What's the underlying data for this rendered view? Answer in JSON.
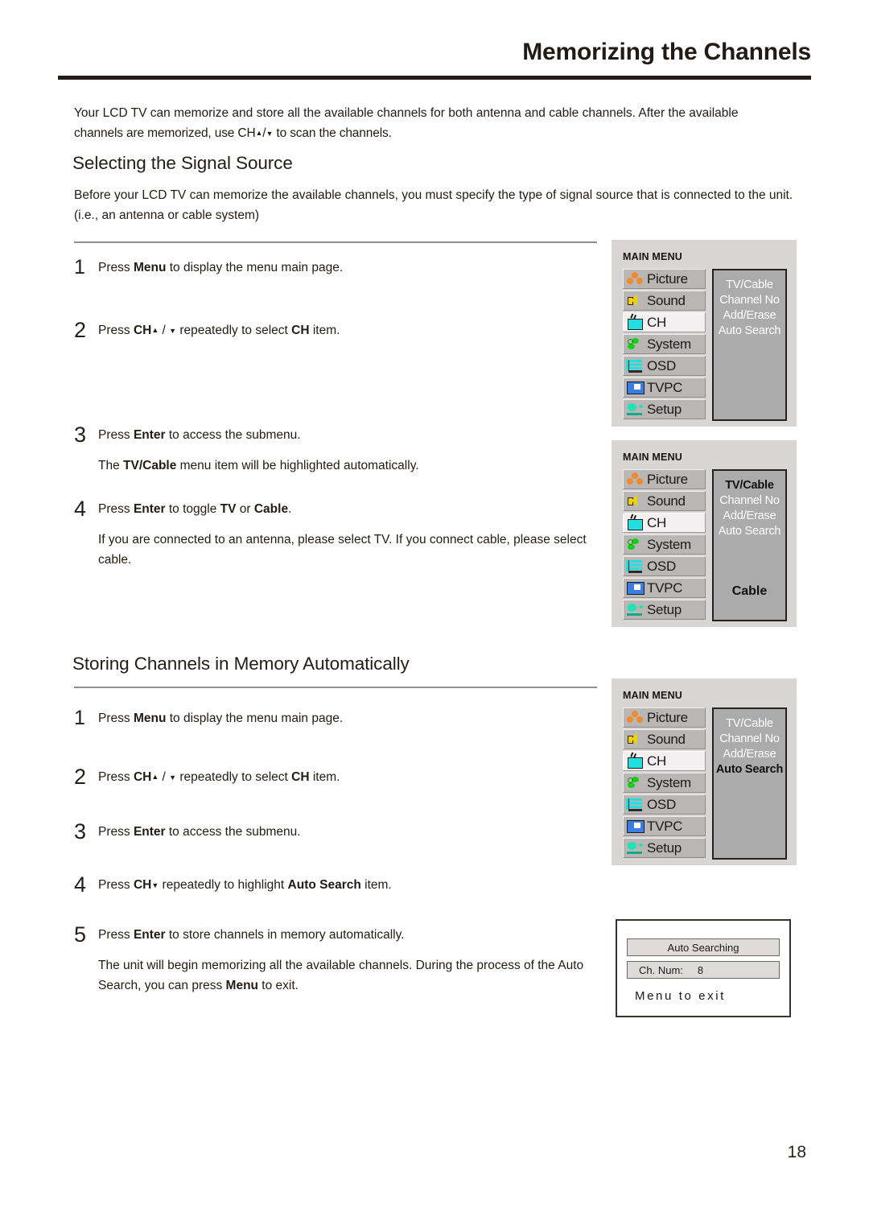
{
  "header": {
    "title": "Memorizing the Channels"
  },
  "intro": {
    "line1": "Your LCD TV can memorize and store all the available channels for both antenna and cable channels. After the  available",
    "line2_a": "channels are memorized, use CH",
    "line2_b": "/",
    "line2_c": "to scan the channels."
  },
  "sections": [
    {
      "heading": "Selecting the Signal Source",
      "body": "Before your LCD TV can memorize the available channels, you must specify the type of signal  source that is connected to the unit. (i.e., an antenna or cable system)",
      "steps": [
        {
          "num": "1",
          "pre": "Press ",
          "bold": "Menu",
          "post": " to display the menu main page.",
          "sub": ""
        },
        {
          "num": "2",
          "pre": "Press ",
          "bold": "CH",
          "post": " repeatedly to select ",
          "bold2": "CH",
          "post2": " item.",
          "sub": ""
        },
        {
          "num": "3",
          "pre": "Press ",
          "bold": "Enter",
          "post": " to access the submenu.",
          "sub_pre": "The ",
          "sub_bold": "TV/Cable",
          "sub_post": " menu item will be highlighted automatically."
        },
        {
          "num": "4",
          "pre": "Press ",
          "bold": "Enter",
          "post": " to toggle ",
          "bold2": "TV",
          "post2": " or ",
          "bold3": "Cable",
          "post3": ".",
          "sub": "If you are connected to an antenna, please select TV. If you connect cable, please select cable."
        }
      ]
    },
    {
      "heading": "Storing Channels in Memory Automatically",
      "steps": [
        {
          "num": "1",
          "pre": "Press ",
          "bold": "Menu",
          "post": " to display the menu main page."
        },
        {
          "num": "2",
          "pre": "Press ",
          "bold": "CH",
          "post": " repeatedly to select ",
          "bold2": "CH",
          "post2": " item."
        },
        {
          "num": "3",
          "pre": "Press ",
          "bold": "Enter",
          "post": " to access the submenu."
        },
        {
          "num": "4",
          "pre": "Press ",
          "bold": "CH",
          "post": " repeatedly to highlight ",
          "bold2": "Auto Search",
          "post2": " item."
        },
        {
          "num": "5",
          "pre": "Press ",
          "bold": "Enter",
          "post": " to store channels in memory automatically.",
          "sub_pre": "The unit will begin memorizing all the available channels. During the process of the Auto Search, you can press ",
          "sub_bold": "Menu",
          "sub_post": " to exit."
        }
      ]
    }
  ],
  "osd": {
    "title": "MAIN MENU",
    "menu_items": [
      {
        "label": "Picture",
        "icon": "picture-icon"
      },
      {
        "label": "Sound",
        "icon": "sound-icon"
      },
      {
        "label": "CH",
        "icon": "tv-icon"
      },
      {
        "label": "System",
        "icon": "system-icon"
      },
      {
        "label": "OSD",
        "icon": "osd-icon"
      },
      {
        "label": "TVPC",
        "icon": "monitor-icon"
      },
      {
        "label": "Setup",
        "icon": "setup-icon"
      }
    ],
    "submenu_items": [
      "TV/Cable",
      "Channel No",
      "Add/Erase",
      "Auto Search"
    ],
    "panels": [
      {
        "selected_menu": "CH",
        "active_submenu": "",
        "value": ""
      },
      {
        "selected_menu": "CH",
        "active_submenu": "TV/Cable",
        "value": "Cable"
      },
      {
        "selected_menu": "CH",
        "active_submenu": "Auto Search",
        "value": ""
      }
    ]
  },
  "search_dialog": {
    "status": "Auto Searching",
    "ch_label": "Ch. Num:",
    "ch_value": "8",
    "exit_hint": "Menu to exit"
  },
  "page_number": "18",
  "colors": {
    "rule": "#241b16",
    "panel_bg": "#d9d5d5",
    "submenu_bg": "#ababab",
    "selected_item_bg": "#f2f0f0"
  }
}
